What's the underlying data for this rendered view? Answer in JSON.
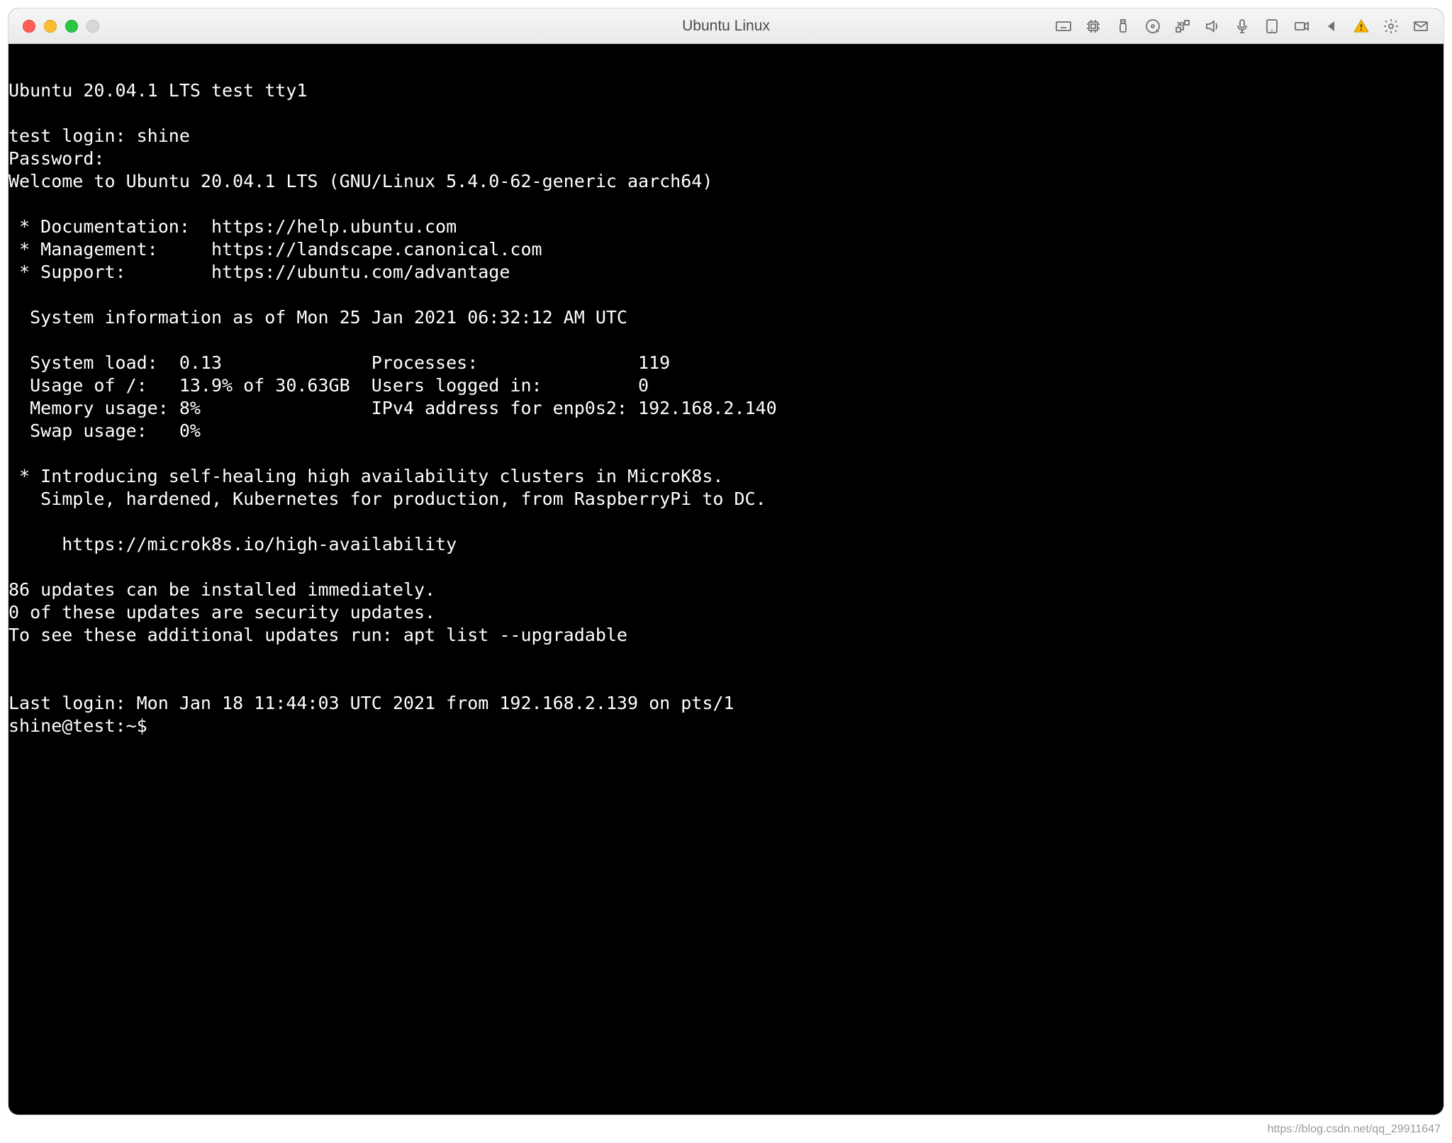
{
  "window": {
    "title": "Ubuntu Linux"
  },
  "terminal": {
    "lines": [
      "Ubuntu 20.04.1 LTS test tty1",
      "",
      "test login: shine",
      "Password:",
      "Welcome to Ubuntu 20.04.1 LTS (GNU/Linux 5.4.0-62-generic aarch64)",
      "",
      " * Documentation:  https://help.ubuntu.com",
      " * Management:     https://landscape.canonical.com",
      " * Support:        https://ubuntu.com/advantage",
      "",
      "  System information as of Mon 25 Jan 2021 06:32:12 AM UTC",
      "",
      "  System load:  0.13              Processes:               119",
      "  Usage of /:   13.9% of 30.63GB  Users logged in:         0",
      "  Memory usage: 8%                IPv4 address for enp0s2: 192.168.2.140",
      "  Swap usage:   0%",
      "",
      " * Introducing self-healing high availability clusters in MicroK8s.",
      "   Simple, hardened, Kubernetes for production, from RaspberryPi to DC.",
      "",
      "     https://microk8s.io/high-availability",
      "",
      "86 updates can be installed immediately.",
      "0 of these updates are security updates.",
      "To see these additional updates run: apt list --upgradable",
      "",
      "",
      "Last login: Mon Jan 18 11:44:03 UTC 2021 from 192.168.2.139 on pts/1",
      "shine@test:~$ "
    ]
  },
  "watermark": "https://blog.csdn.net/qq_29911647"
}
